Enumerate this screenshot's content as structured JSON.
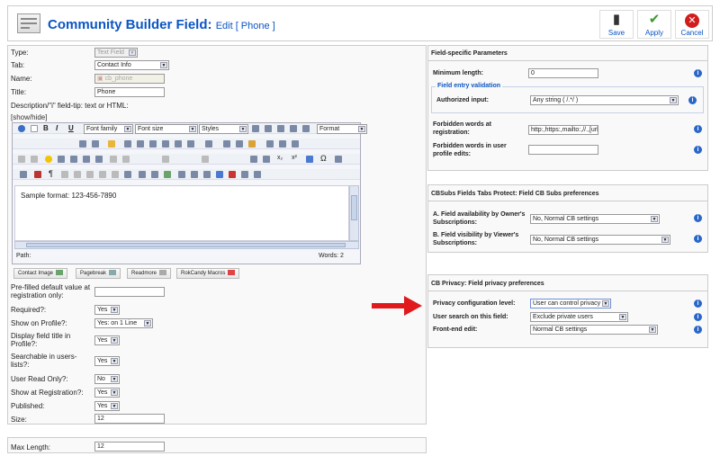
{
  "header": {
    "title": "Community Builder Field:",
    "subtitle": "Edit [ Phone ]",
    "toolbar": {
      "save": "Save",
      "apply": "Apply",
      "cancel": "Cancel"
    }
  },
  "left": {
    "type_label": "Type:",
    "type_value": "Text Field",
    "tab_label": "Tab:",
    "tab_value": "Contact Info",
    "name_label": "Name:",
    "name_value": "cb_phone",
    "title_label": "Title:",
    "title_value": "Phone",
    "desc_label": "Description/\"i\" field-tip: text or HTML:",
    "showhide": "[show/hide]",
    "editor": {
      "font_family": "Font family",
      "font_size": "Font size",
      "styles": "Styles",
      "format": "Format",
      "content": "Sample format:  123-456-7890",
      "path_label": "Path:",
      "words": "Words: 2"
    },
    "editor_buttons": [
      "Contact Image",
      "Pagebreak",
      "Readmore",
      "RokCandy Macros"
    ],
    "prefilled_label": "Pre-filled default value at registration only:",
    "required_label": "Required?:",
    "required_value": "Yes",
    "show_profile_label": "Show on Profile?:",
    "show_profile_value": "Yes: on 1 Line",
    "display_title_label": "Display field title in Profile?:",
    "display_title_value": "Yes",
    "searchable_label": "Searchable in users-lists?:",
    "searchable_value": "Yes",
    "readonly_label": "User Read Only?:",
    "readonly_value": "No",
    "show_reg_label": "Show at Registration?:",
    "show_reg_value": "Yes",
    "published_label": "Published:",
    "published_value": "Yes",
    "size_label": "Size:",
    "size_value": "12",
    "maxlen_label": "Max Length:",
    "maxlen_value": "12"
  },
  "right": {
    "params_title": "Field-specific Parameters",
    "min_len_label": "Minimum length:",
    "min_len_value": "0",
    "validation_legend": "Field entry validation",
    "auth_input_label": "Authorized input:",
    "auth_input_value": "Any string ( /.*/ )",
    "forbidden_reg_label": "Forbidden words at registration:",
    "forbidden_reg_value": "http:,https:,mailto:,//.,[url]",
    "forbidden_edit_label": "Forbidden words in user profile edits:",
    "cbsubs_title": "CBSubs Fields Tabs Protect: Field CB Subs preferences",
    "avail_label": "A. Field availability by Owner's Subscriptions:",
    "avail_value": "No, Normal CB settings",
    "visib_label": "B. Field visibility by Viewer's Subscriptions:",
    "visib_value": "No, Normal CB settings",
    "privacy_title": "CB Privacy: Field privacy preferences",
    "priv_level_label": "Privacy configuration level:",
    "priv_level_value": "User can control privacy",
    "user_search_label": "User search on this field:",
    "user_search_value": "Exclude private users",
    "frontend_label": "Front-end edit:",
    "frontend_value": "Normal CB settings"
  },
  "colors": {
    "title_blue": "#0b55c4",
    "arrow_red": "#e0191d",
    "info_blue": "#2a67c8"
  }
}
